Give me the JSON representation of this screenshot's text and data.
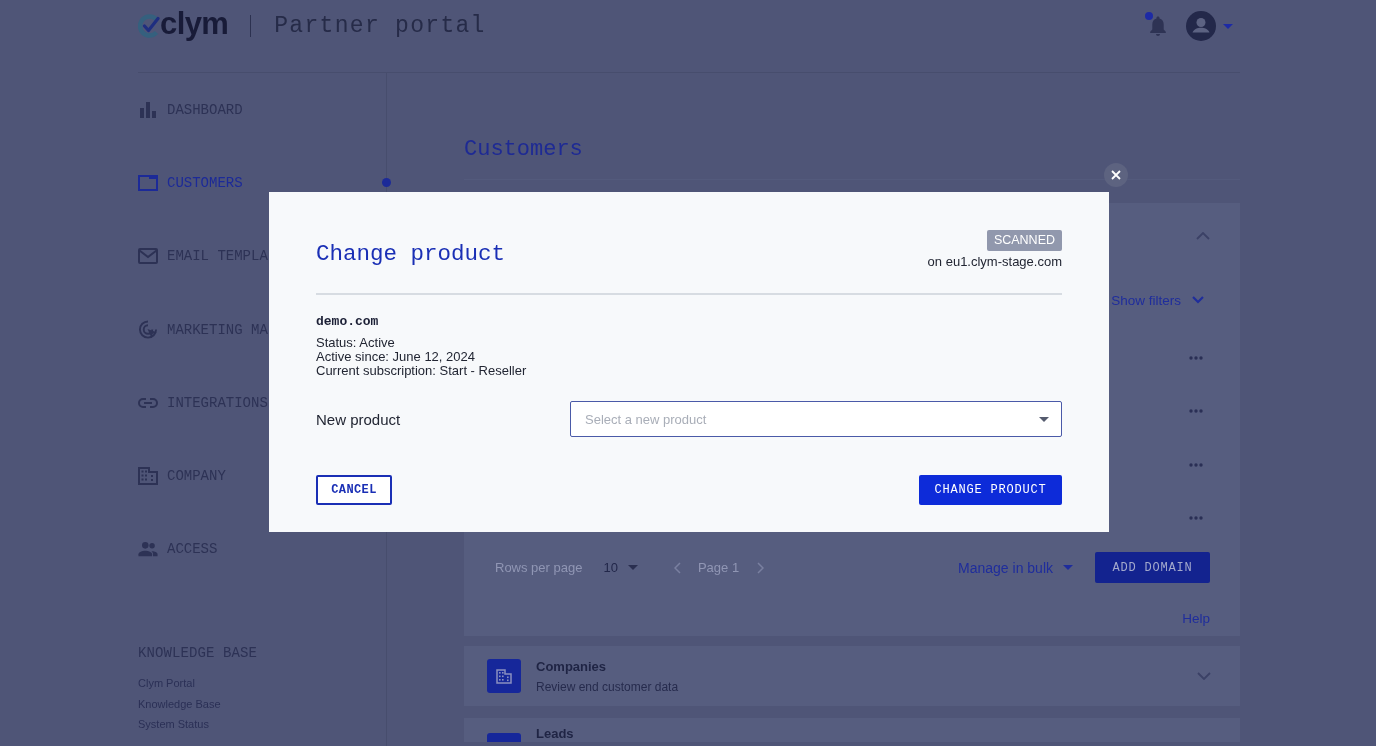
{
  "header": {
    "logo": "clym",
    "title": "Partner portal",
    "has_notification": true
  },
  "sidebar": {
    "items": [
      {
        "label": "DASHBOARD",
        "selected": false
      },
      {
        "label": "CUSTOMERS",
        "selected": true
      },
      {
        "label": "EMAIL TEMPLA",
        "selected": false
      },
      {
        "label": "MARKETING MA",
        "selected": false
      },
      {
        "label": "INTEGRATIONS",
        "selected": false
      },
      {
        "label": "COMPANY",
        "selected": false
      },
      {
        "label": "ACCESS",
        "selected": false
      }
    ],
    "knowledge_base": {
      "heading": "KNOWLEDGE BASE",
      "links": [
        "Clym Portal",
        "Knowledge Base",
        "System Status"
      ]
    }
  },
  "main": {
    "title": "Customers",
    "domains_panel": {
      "expanded": true,
      "filters_link": "Show filters",
      "rows": [
        {
          "actions_menu": true
        },
        {
          "actions_menu": true
        },
        {
          "actions_menu": true
        },
        {
          "actions_menu": true
        }
      ],
      "footer": {
        "rows_per_page_label": "Rows per page",
        "rows_per_page": "10",
        "page": "Page 1",
        "bulk_menu": "Manage in bulk",
        "add_button": "ADD DOMAIN"
      },
      "help_link": "Help"
    },
    "sections": [
      {
        "title": "Companies",
        "subtitle": "Review end customer data",
        "expanded": false
      },
      {
        "title": "Leads"
      }
    ]
  },
  "modal": {
    "title": "Change product",
    "badge": "SCANNED",
    "host": "on eu1.clym-stage.com",
    "domain": "demo.com",
    "details": [
      "Status: Active",
      "Active since: June 12, 2024",
      "Current subscription: Start - Reseller"
    ],
    "field": {
      "label": "New product",
      "placeholder": "Select a new product"
    },
    "buttons": [
      {
        "label": "CANCEL",
        "kind": "secondary"
      },
      {
        "label": "CHANGE PRODUCT",
        "kind": "primary"
      }
    ]
  }
}
